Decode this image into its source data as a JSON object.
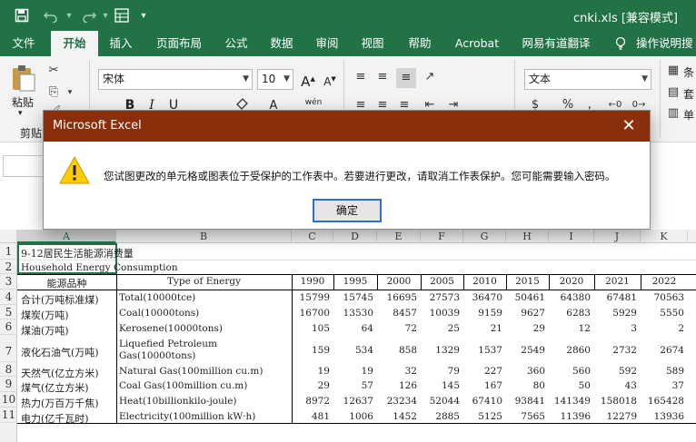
{
  "titlebar": {
    "title": "cnki.xls  [兼容模式]",
    "quick_access": [
      "save-icon",
      "undo-icon",
      "redo-icon",
      "form-icon"
    ]
  },
  "tabs": [
    "文件",
    "开始",
    "插入",
    "页面布局",
    "公式",
    "数据",
    "审阅",
    "视图",
    "帮助",
    "Acrobat",
    "网易有道翻译",
    "操作说明搜"
  ],
  "active_tab": "开始",
  "ribbon": {
    "paste_label": "粘贴",
    "clipboard_label": "剪贴",
    "font_name": "宋体",
    "font_size": "10",
    "grow_font": "A",
    "shrink_font": "A",
    "bold": "B",
    "italic": "I",
    "underline": "U",
    "phonetic": "wén",
    "number_format": "文本",
    "right_labels": [
      "条",
      "套",
      "单"
    ]
  },
  "dialog": {
    "title": "Microsoft Excel",
    "close": "✕",
    "message": "您试图更改的单元格或图表位于受保护的工作表中。若要进行更改，请取消工作表保护。您可能需要输入密码。",
    "ok_label": "确定"
  },
  "columns": [
    "A",
    "B",
    "C",
    "D",
    "E",
    "F",
    "G",
    "H",
    "I",
    "J",
    "K"
  ],
  "selected_column": "A",
  "rows": [
    "1",
    "2",
    "3",
    "4",
    "5",
    "6",
    "7",
    "8",
    "9",
    "10",
    "11"
  ],
  "sheet": {
    "a1": "9-12居民生活能源消费量",
    "a2": "Household Energy Consumption",
    "header_a": "能源品种",
    "header_b": "Type of Energy",
    "years": [
      "1990",
      "1995",
      "2000",
      "2005",
      "2010",
      "2015",
      "2020",
      "2021",
      "2022"
    ],
    "data_rows": [
      {
        "cn": "合计(万吨标准煤)",
        "en": "Total(10000tce)",
        "values": [
          "15799",
          "15745",
          "16695",
          "27573",
          "36470",
          "50461",
          "64380",
          "67481",
          "70563"
        ]
      },
      {
        "cn": "煤炭(万吨)",
        "en": "Coal(10000tons)",
        "values": [
          "16700",
          "13530",
          "8457",
          "10039",
          "9159",
          "9627",
          "6283",
          "5929",
          "5550"
        ]
      },
      {
        "cn": "煤油(万吨)",
        "en": "Kerosene(10000tons)",
        "values": [
          "105",
          "64",
          "72",
          "25",
          "21",
          "29",
          "12",
          "3",
          "2"
        ]
      },
      {
        "cn": "液化石油气(万吨)",
        "en": "Liquefied Petroleum\nGas(10000tons)",
        "values": [
          "159",
          "534",
          "858",
          "1329",
          "1537",
          "2549",
          "2860",
          "2732",
          "2674"
        ]
      },
      {
        "cn": "天然气(亿立方米)",
        "en": "Natural Gas(100million cu.m)",
        "values": [
          "19",
          "19",
          "32",
          "79",
          "227",
          "360",
          "560",
          "592",
          "589"
        ]
      },
      {
        "cn": "煤气(亿立方米)",
        "en": "Coal Gas(100million cu.m)",
        "values": [
          "29",
          "57",
          "126",
          "145",
          "167",
          "80",
          "50",
          "43",
          "37"
        ]
      },
      {
        "cn": "热力(万百万千焦)",
        "en": "Heat(10billionkilo-joule)",
        "values": [
          "8972",
          "12637",
          "23234",
          "52044",
          "67410",
          "93841",
          "141349",
          "158018",
          "165428"
        ]
      },
      {
        "cn": "电力(亿千瓦时)",
        "en": "Electricity(100million kW·h)",
        "values": [
          "481",
          "1006",
          "1452",
          "2885",
          "5125",
          "7565",
          "11396",
          "12279",
          "13936"
        ]
      }
    ]
  },
  "colors": {
    "excel_green": "#217346",
    "dialog_title": "#8a2f0b",
    "ok_border": "#2b6fd6"
  }
}
